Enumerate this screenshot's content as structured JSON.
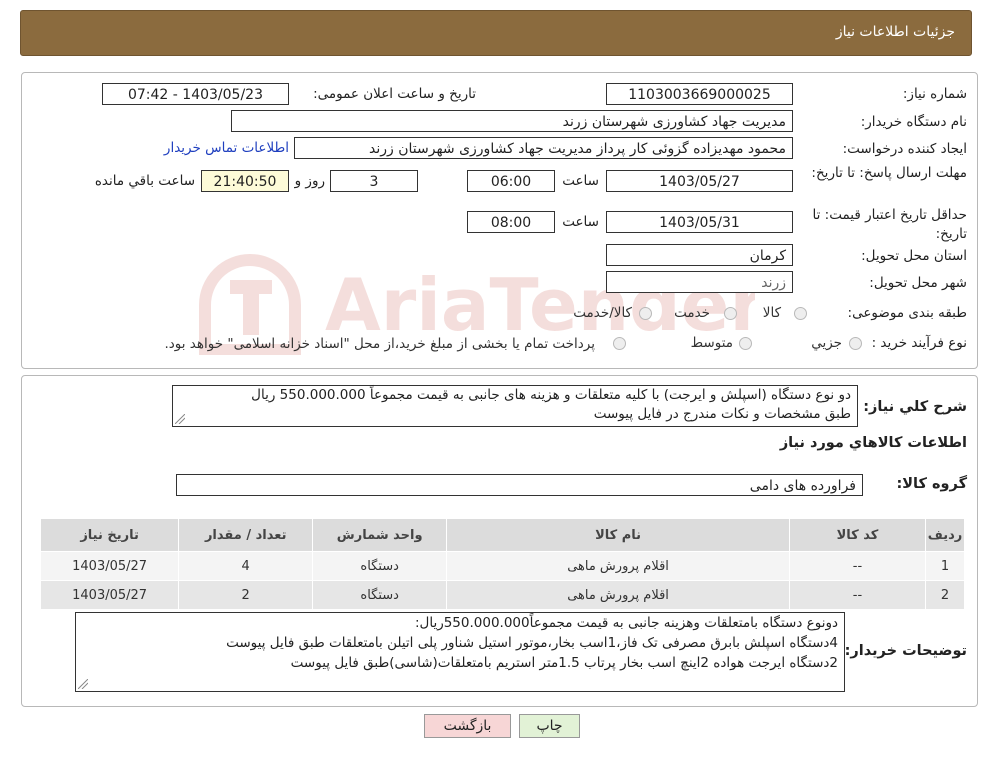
{
  "header": {
    "title": "جزئیات اطلاعات نیاز"
  },
  "form": {
    "need_number_label": "شماره نیاز:",
    "need_number": "1103003669000025",
    "announce_label": "تاریخ و ساعت اعلان عمومی:",
    "announce_value": "1403/05/23 - 07:42",
    "buyer_label": "نام دستگاه خریدار:",
    "buyer_value": "مدیریت جهاد کشاورزی شهرستان زرند",
    "creator_label": "ایجاد کننده درخواست:",
    "creator_value": "محمود مهدیزاده گزوئی کار پرداز مدیریت جهاد کشاورزی شهرستان زرند",
    "contact_link": "اطلاعات تماس خریدار",
    "deadline_label": "مهلت ارسال پاسخ: تا تاریخ:",
    "deadline_date": "1403/05/27",
    "time_label": "ساعت",
    "deadline_time": "06:00",
    "days_value": "3",
    "days_label": "روز و",
    "remaining_value": "21:40:50",
    "remaining_label": "ساعت باقي مانده",
    "validity_label": "حداقل تاریخ اعتبار قیمت: تا تاریخ:",
    "validity_date": "1403/05/31",
    "validity_time": "08:00",
    "province_label": "استان محل تحویل:",
    "province_value": "کرمان",
    "city_label": "شهر محل تحویل:",
    "city_value": "زرند",
    "category_label": "طبقه بندی موضوعی:",
    "category_options": [
      "کالا",
      "خدمت",
      "کالا/خدمت"
    ],
    "process_label": "نوع فرآیند خرید :",
    "process_options": [
      "جزیي",
      "متوسط"
    ],
    "process_note": "پرداخت تمام یا بخشی از مبلغ خرید،از محل \"اسناد خزانه اسلامی\" خواهد بود."
  },
  "description": {
    "label": "شرح كلي نياز:",
    "line1": "دو نوع دستگاه (اسپلش و ایرجت) با کلیه متعلقات و هزینه های جانبی به قیمت مجموعاً 550.000.000 ریال",
    "line2": "طبق مشخصات و نکات مندرج در فایل پیوست"
  },
  "goods": {
    "section_title": "اطلاعات کالاهاي مورد نياز",
    "group_label": "گروه کالا:",
    "group_value": "فراورده های دامی"
  },
  "table": {
    "headers": [
      "ردیف",
      "کد کالا",
      "نام کالا",
      "واحد شمارش",
      "تعداد / مقدار",
      "تاریخ نیاز"
    ],
    "rows": [
      [
        "1",
        "--",
        "اقلام پرورش ماهی",
        "دستگاه",
        "4",
        "1403/05/27"
      ],
      [
        "2",
        "--",
        "اقلام پرورش ماهی",
        "دستگاه",
        "2",
        "1403/05/27"
      ]
    ]
  },
  "notes": {
    "label": "توضیحات خریدار:",
    "line1": "دونوع دستگاه بامتعلقات وهزینه جانبی به قیمت مجموعاً550.000.000ریال:",
    "line2": "4دستگاه اسپلش بابرق مصرفی تک فاز،1اسب بخار،موتور استیل شناور پلی اتیلن بامتعلقات طبق فایل پیوست",
    "line3": "2دستگاه ایرجت هواده 2اینچ اسب بخار پرتاب 1.5متر استریم بامتعلقات(شاسی)طبق فایل پیوست"
  },
  "buttons": {
    "print": "چاپ",
    "back": "بازگشت"
  },
  "watermark": "AriaTender.neT",
  "colors": {
    "header": "#8b6b3e",
    "back_button": "#f7d6d6",
    "print_button": "#e2f2d6",
    "link": "#1f3fbf",
    "countdown": "#fdfbd8"
  }
}
